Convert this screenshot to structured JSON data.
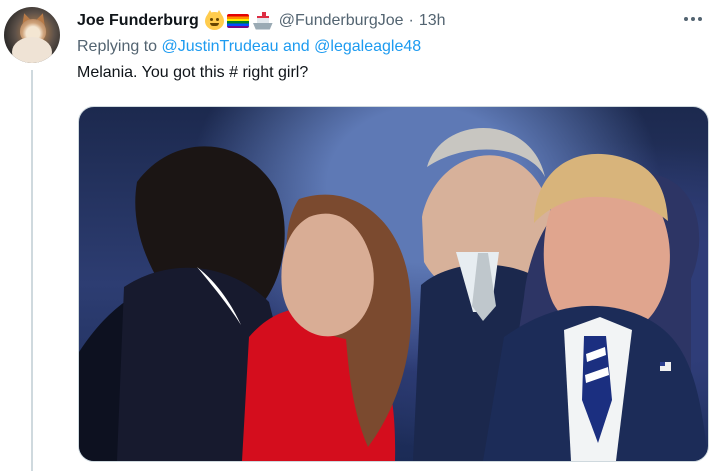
{
  "author": {
    "name": "Joe Funderburg",
    "emoji_icons": [
      "cat-face-icon",
      "rainbow-flag-icon",
      "ship-icon"
    ],
    "handle": "@FunderburgJoe",
    "separator": "·",
    "timestamp": "13h"
  },
  "reply": {
    "prefix": "Replying to ",
    "mention_1": "@JustinTrudeau",
    "joiner": " and ",
    "mention_2": "@legaleagle48"
  },
  "tweet": {
    "text": "Melania. You got this # right girl?"
  },
  "menu": {
    "icon": "more-options-icon"
  },
  "media": {
    "type": "photo"
  },
  "colors": {
    "accent": "#1d9bf0",
    "muted": "#536471",
    "text": "#0f1419",
    "thread_line": "#cfd9de"
  }
}
